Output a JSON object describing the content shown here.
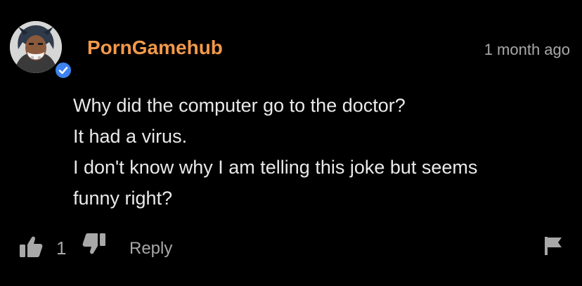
{
  "comment": {
    "username": "PornGamehub",
    "timestamp": "1 month ago",
    "verified": true,
    "lines": [
      "Why did the computer go to the doctor?",
      "It had a virus.",
      "I don't know why I am telling this joke but seems",
      "funny right?"
    ]
  },
  "actions": {
    "like_count": "1",
    "reply_label": "Reply"
  },
  "icons": {
    "avatar": "avatar-image",
    "verified": "check-badge-icon",
    "like": "thumbs-up-icon",
    "dislike": "thumbs-down-icon",
    "flag": "flag-icon"
  },
  "colors": {
    "background": "#000000",
    "username": "#f2994a",
    "body_text": "#e9e9e9",
    "muted": "#a8a8a8",
    "verified_badge": "#3d82f0"
  }
}
